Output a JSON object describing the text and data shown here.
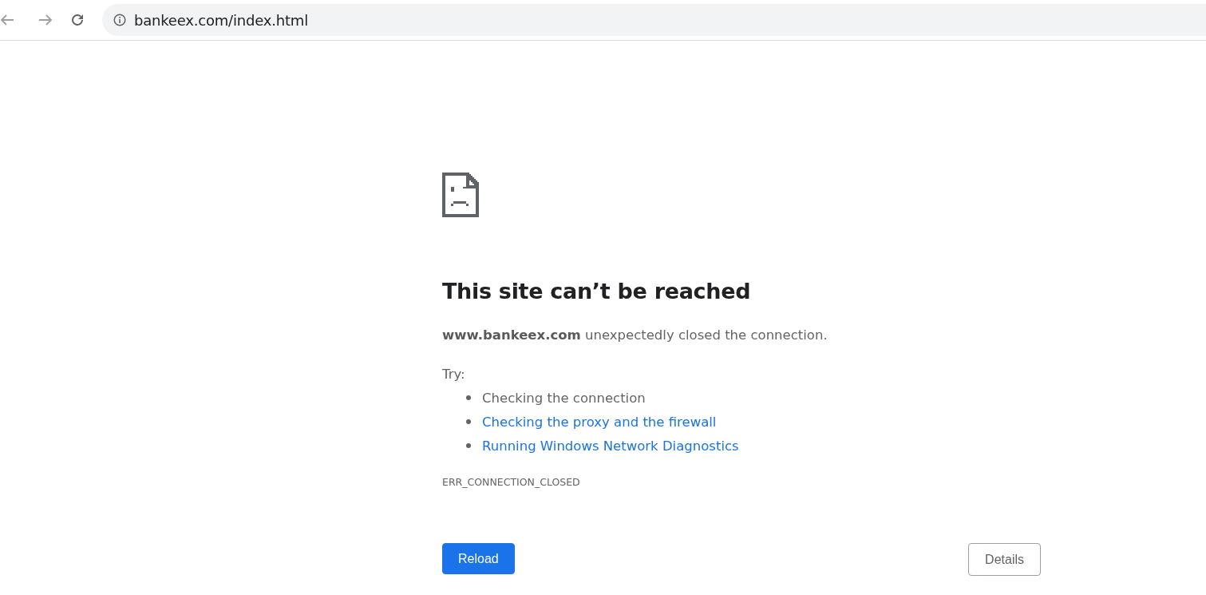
{
  "toolbar": {
    "url": "bankeex.com/index.html"
  },
  "error": {
    "title": "This site can’t be reached",
    "message": "**www.bankeex.com** unexpectedly closed the connection.",
    "try_label": "Try:",
    "suggestions": [
      {
        "kind": "text",
        "text": "Checking the connection"
      },
      {
        "kind": "link",
        "text": "Checking the proxy and the firewall"
      },
      {
        "kind": "link",
        "text": "Running Windows Network Diagnostics"
      }
    ],
    "code": "ERR_CONNECTION_CLOSED",
    "buttons": [
      {
        "kind": "primary",
        "label": "Reload"
      },
      {
        "kind": "secondary",
        "label": "Details"
      }
    ]
  }
}
